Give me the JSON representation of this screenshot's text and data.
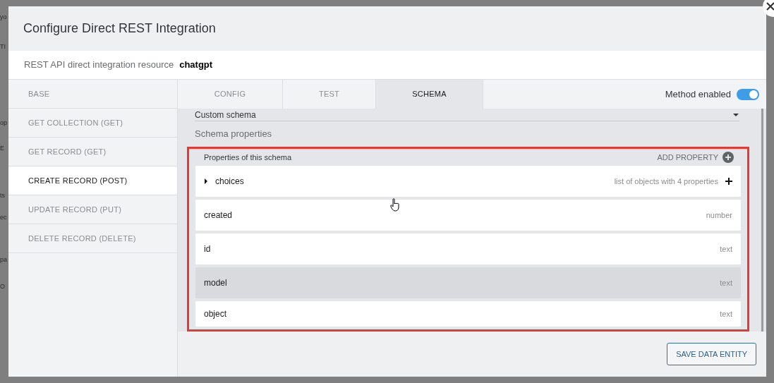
{
  "background": {
    "fragments": [
      "yo",
      "TI",
      "op",
      "E",
      "ts",
      "ec",
      "pa",
      "O"
    ]
  },
  "dialog": {
    "title": "Configure Direct REST Integration",
    "resource_label": "REST API direct integration resource",
    "resource_value": "chatgpt"
  },
  "methods": [
    {
      "label": "BASE",
      "selected": false
    },
    {
      "label": "GET COLLECTION (GET)",
      "selected": false
    },
    {
      "label": "GET RECORD (GET)",
      "selected": false
    },
    {
      "label": "CREATE RECORD (POST)",
      "selected": true
    },
    {
      "label": "UPDATE RECORD (PUT)",
      "selected": false
    },
    {
      "label": "DELETE RECORD (DELETE)",
      "selected": false
    }
  ],
  "tabs": [
    {
      "label": "CONFIG",
      "selected": false
    },
    {
      "label": "TEST",
      "selected": false
    },
    {
      "label": "SCHEMA",
      "selected": true
    }
  ],
  "method_enabled": {
    "label": "Method enabled",
    "on": true
  },
  "schema": {
    "select_value": "Custom schema",
    "section_title": "Schema properties",
    "properties_title": "Properties of this schema",
    "add_property": "ADD PROPERTY",
    "properties": [
      {
        "kind": "object",
        "name": "choices",
        "type": "list of objects with 4 properties",
        "expanded": false,
        "highlighted": false
      },
      {
        "kind": "field",
        "name": "created",
        "type": "number",
        "highlighted": false
      },
      {
        "kind": "field",
        "name": "id",
        "type": "text",
        "highlighted": false
      },
      {
        "kind": "field",
        "name": "model",
        "type": "text",
        "highlighted": true
      },
      {
        "kind": "field",
        "name": "object",
        "type": "text",
        "highlighted": false
      }
    ]
  },
  "save_button": "SAVE DATA ENTITY"
}
